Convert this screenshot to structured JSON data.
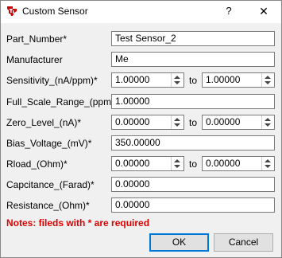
{
  "window": {
    "title": "Custom Sensor",
    "help_label": "?",
    "close_label": "✕"
  },
  "fields": {
    "part_number": {
      "label": "Part_Number*",
      "value": "Test Sensor_2"
    },
    "manufacturer": {
      "label": "Manufacturer",
      "value": "Me"
    },
    "sensitivity": {
      "label": "Sensitivity_(nA/ppm)*",
      "value": "1.00000",
      "to_label": "to",
      "to_value": "1.00000"
    },
    "full_scale_range": {
      "label": "Full_Scale_Range_(ppm)*",
      "value": "1.00000"
    },
    "zero_level": {
      "label": "Zero_Level_(nA)*",
      "value": "0.00000",
      "to_label": "to",
      "to_value": "0.00000"
    },
    "bias_voltage": {
      "label": "Bias_Voltage_(mV)*",
      "value": "350.00000"
    },
    "rload": {
      "label": "Rload_(Ohm)*",
      "value": "0.00000",
      "to_label": "to",
      "to_value": "0.00000"
    },
    "capacitance": {
      "label": "Capcitance_(Farad)*",
      "value": "0.00000"
    },
    "resistance": {
      "label": "Resistance_(Ohm)*",
      "value": "0.00000"
    }
  },
  "note": "Notes:  fileds with * are required",
  "buttons": {
    "ok": "OK",
    "cancel": "Cancel"
  },
  "colors": {
    "note": "#e00000",
    "accent": "#0078d7",
    "logo": "#cc0000"
  }
}
